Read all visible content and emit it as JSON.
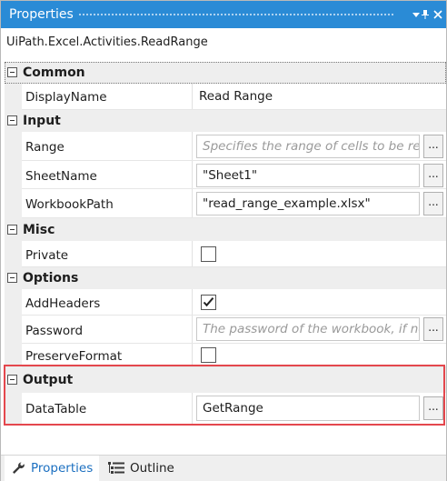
{
  "panel": {
    "title": "Properties"
  },
  "activity_type": "UiPath.Excel.Activities.ReadRange",
  "categories": [
    {
      "label": "Common",
      "properties": [
        {
          "name": "DisplayName",
          "value": "Read Range"
        }
      ]
    },
    {
      "label": "Input",
      "properties": [
        {
          "name": "Range",
          "placeholder": "Specifies the range of cells to be read"
        },
        {
          "name": "SheetName",
          "value": "\"Sheet1\""
        },
        {
          "name": "WorkbookPath",
          "value": "\"read_range_example.xlsx\""
        }
      ]
    },
    {
      "label": "Misc",
      "properties": [
        {
          "name": "Private",
          "checked": false
        }
      ]
    },
    {
      "label": "Options",
      "properties": [
        {
          "name": "AddHeaders",
          "checked": true
        },
        {
          "name": "Password",
          "placeholder": "The password of the workbook, if needed"
        },
        {
          "name": "PreserveFormat",
          "checked": false
        }
      ]
    },
    {
      "label": "Output",
      "properties": [
        {
          "name": "DataTable",
          "value": "GetRange"
        }
      ]
    }
  ],
  "ellipsis_label": "...",
  "tabs": [
    {
      "label": "Properties",
      "active": true
    },
    {
      "label": "Outline",
      "active": false
    }
  ],
  "icons": {
    "title_dropdown": "chevron-down-icon",
    "pin": "pin-icon",
    "close": "close-icon",
    "properties_tab": "wrench-icon",
    "outline_tab": "outline-tree-icon"
  },
  "colors": {
    "accent": "#2a8bd6",
    "highlight": "#e4474d",
    "active_tab_text": "#1b6fc0"
  }
}
